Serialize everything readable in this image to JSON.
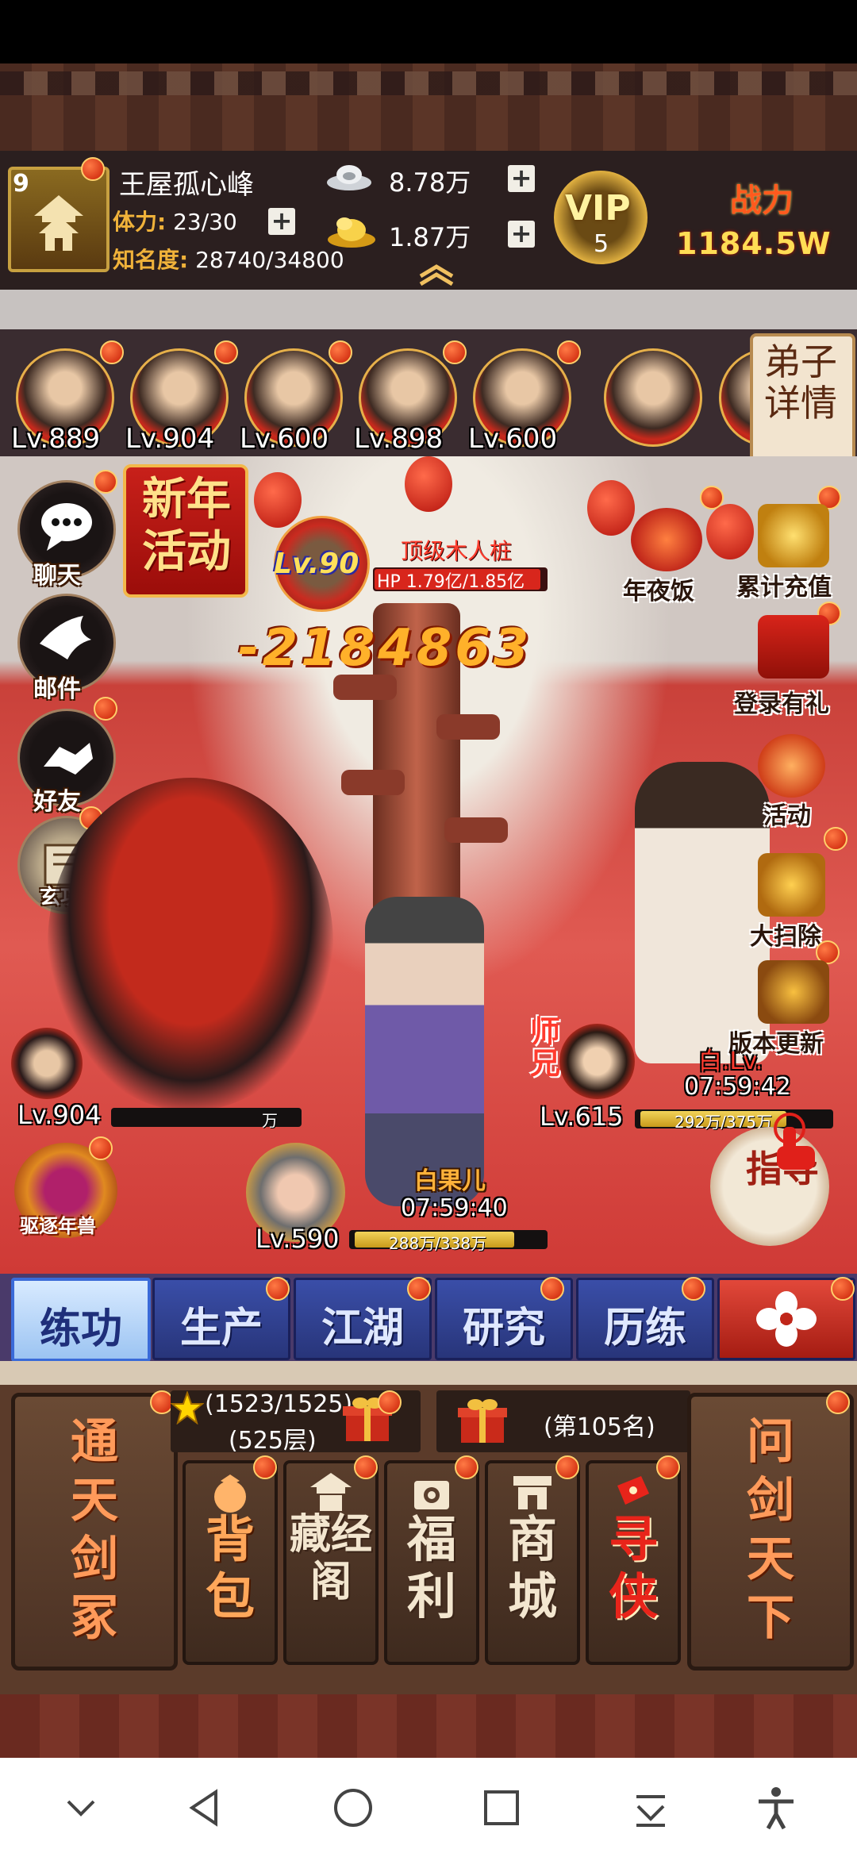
{
  "player": {
    "name": "王屋孤心峰",
    "level": "9",
    "stamina_label": "体力:",
    "stamina_value": "23/30",
    "fame_label": "知名度:",
    "fame_value": "28740/34800"
  },
  "currency": {
    "silver": "8.78万",
    "gold": "1.87万"
  },
  "vip": {
    "label": "VIP",
    "level": "5"
  },
  "power": {
    "label": "战力",
    "value": "1184.5W"
  },
  "disciples": [
    {
      "level": "Lv.889"
    },
    {
      "level": "Lv.904"
    },
    {
      "level": "Lv.600"
    },
    {
      "level": "Lv.898"
    },
    {
      "level": "Lv.600"
    }
  ],
  "disciple_detail_label": "弟子详情",
  "left_menu": {
    "chat": "聊天",
    "mail": "邮件",
    "friends": "好友",
    "xuangong": "玄功"
  },
  "new_year_event": "新年活动",
  "boss": {
    "level": "Lv.90",
    "name": "顶级木人桩",
    "hp": "HP 1.79亿/1.85亿",
    "hp_ratio": 0.967
  },
  "damage": "-2184863",
  "right_menu": {
    "reunion_dinner": "年夜饭",
    "cumulative_recharge": "累计充值",
    "login_gift": "登录有礼",
    "activity": "活动",
    "big_sweep": "大扫除",
    "version_update": "版本更新"
  },
  "units": {
    "left": {
      "level": "Lv.904",
      "power_suffix": "万"
    },
    "bottom": {
      "level": "Lv.590",
      "name": "白果儿",
      "timer": "07:59:40",
      "power": "288万/338万",
      "ratio": 0.852
    },
    "right": {
      "level": "Lv.615",
      "tag": "师兄",
      "name": "白.Lv.",
      "timer": "07:59:42",
      "power": "292万/375万",
      "ratio": 0.779
    }
  },
  "guide_label": "指导",
  "nian_label": "驱逐年兽",
  "tabs": [
    "练功",
    "生产",
    "江湖",
    "研究",
    "历练"
  ],
  "bottom": {
    "tongtian": "通天剑冢",
    "tower_progress": "(1523/1525)",
    "tower_floor": "(525层)",
    "rank": "(第105名)",
    "wenjian": "问剑天下",
    "buttons": [
      "背包",
      "藏经阁",
      "福利",
      "商城",
      "寻侠"
    ]
  },
  "colors": {
    "gold": "#f0b23a",
    "tab_blue": "#3a4ea8",
    "accent_red": "#c81d05"
  }
}
